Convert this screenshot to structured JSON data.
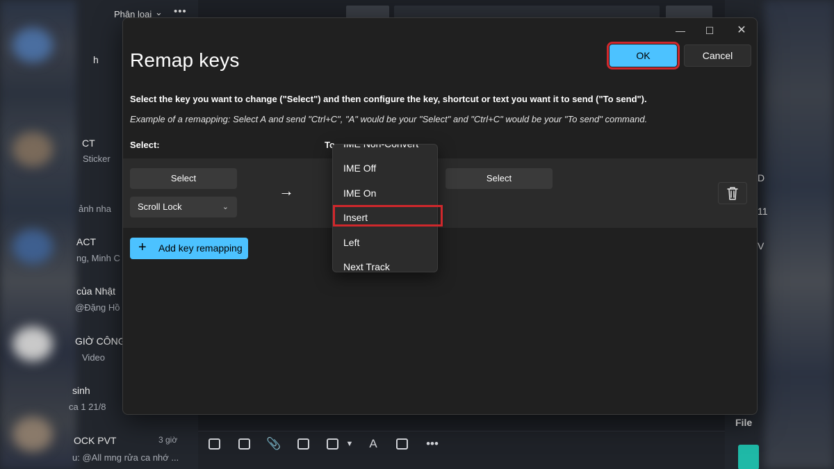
{
  "background": {
    "left_header": "Phân loại",
    "conversations": [
      {
        "title": "h",
        "sub": ""
      },
      {
        "title": "CT",
        "sub": "Sticker"
      },
      {
        "title": "",
        "sub": "ảnh nha"
      },
      {
        "title": "ACT",
        "sub": "ng, Minh C"
      },
      {
        "title": "của Nhật",
        "sub": "@Đặng Hồ"
      },
      {
        "title": "GIỜ CÔNG",
        "sub": "Video"
      },
      {
        "title": "sinh",
        "sub": "ca 1 21/8"
      },
      {
        "title": "OCK PVT",
        "sub": "u: @All mng rửa ca nhớ ..."
      }
    ],
    "badge_time": "3 giờ",
    "right_file_label": "File",
    "right_fragments": [
      "D",
      "11",
      "V"
    ],
    "colors": {
      "accent": "#4cc2ff",
      "highlight_border": "#d0282c",
      "dialog_bg": "#202020"
    }
  },
  "dialog": {
    "title": "Remap keys",
    "ok_label": "OK",
    "cancel_label": "Cancel",
    "instruction": "Select the key you want to change (\"Select\") and then configure the key, shortcut or text you want it to send (\"To send\").",
    "example": "Example of a remapping: Select A and send \"Ctrl+C\", \"A\" would be your \"Select\" and \"Ctrl+C\" would be your \"To send\" command.",
    "col_select": "Select:",
    "col_tosend": "To",
    "row": {
      "select_button": "Select",
      "selected_key": "Scroll Lock",
      "select_button_right": "Select"
    },
    "add_button": "Add key remapping",
    "dropdown_items": [
      "IME Non-Convert",
      "IME Off",
      "IME On",
      "Insert",
      "Left",
      "Next Track"
    ],
    "highlighted_item": "Insert"
  }
}
